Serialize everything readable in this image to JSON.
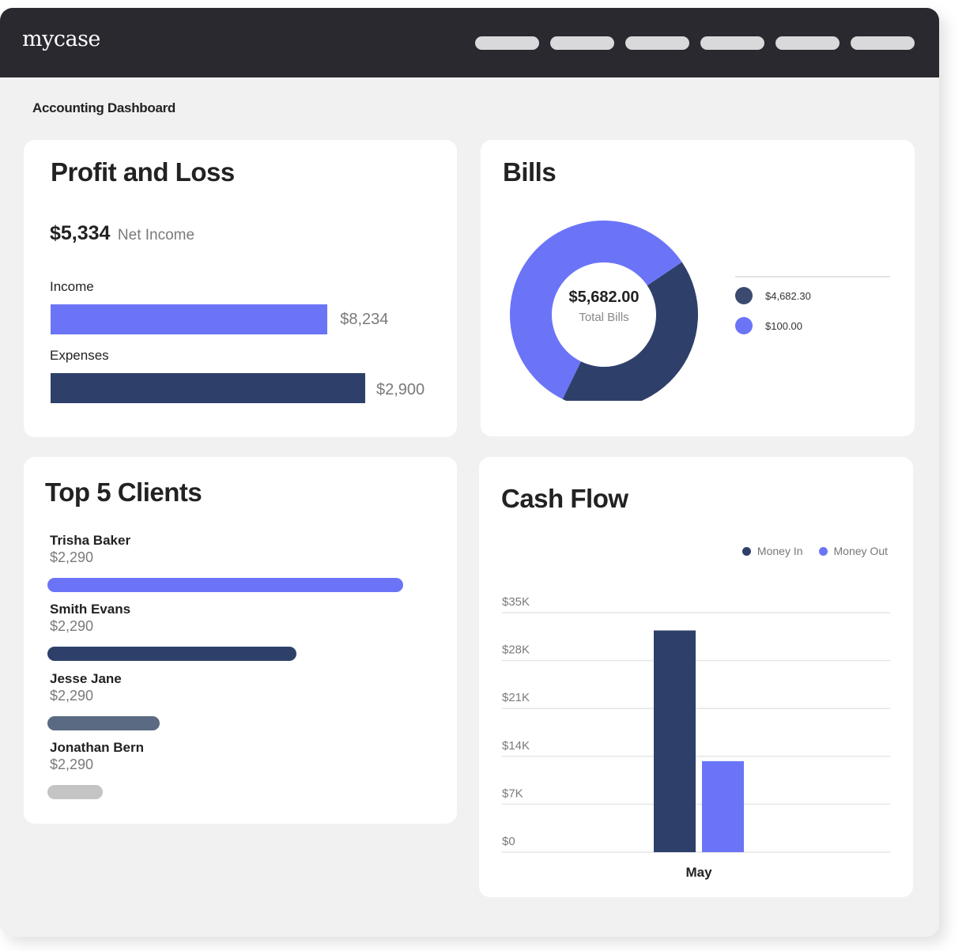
{
  "app": {
    "logo": "mycase",
    "nav_pill_count": 6,
    "page_title": "Accounting Dashboard"
  },
  "colors": {
    "topbar": "#2a292f",
    "accent_light": "#6b74f7",
    "accent_dark": "#2e406a",
    "slate": "#5a6a82",
    "gray_bar": "#c4c4c4"
  },
  "profit_loss": {
    "title": "Profit and Loss",
    "net_value": "$5,334",
    "net_label": "Net Income",
    "income": {
      "label": "Income",
      "value_text": "$8,234",
      "bar_fraction": 0.88
    },
    "expenses": {
      "label": "Expenses",
      "value_text": "$2,900",
      "bar_fraction": 1.0
    }
  },
  "bills": {
    "title": "Bills",
    "total": "$5,682.00",
    "total_label": "Total Bills",
    "legend": [
      {
        "label": "$4,682.30",
        "color": "#3b4a6e"
      },
      {
        "label": "$100.00",
        "color": "#6b74f7"
      }
    ]
  },
  "top_clients": {
    "title": "Top 5 Clients",
    "clients": [
      {
        "name": "Trisha Baker",
        "amount": "$2,290",
        "bar_fraction": 1.0,
        "color": "#6b74f7"
      },
      {
        "name": "Smith Evans",
        "amount": "$2,290",
        "bar_fraction": 0.7,
        "color": "#2e406a"
      },
      {
        "name": "Jesse Jane",
        "amount": "$2,290",
        "bar_fraction": 0.315,
        "color": "#5a6a82"
      },
      {
        "name": "Jonathan Bern",
        "amount": "$2,290",
        "bar_fraction": 0.155,
        "color": "#c4c4c4"
      }
    ]
  },
  "cash_flow": {
    "title": "Cash Flow"
  },
  "chart_data": [
    {
      "type": "pie",
      "title": "Bills",
      "center_text": "$5,682.00",
      "center_subtext": "Total Bills",
      "donut": true,
      "slices": [
        {
          "label": "$4,682.30",
          "fraction": 0.417,
          "color": "#2e406a"
        },
        {
          "label": "$100.00",
          "fraction": 0.583,
          "color": "#6b74f7"
        }
      ],
      "start_angle_deg": 56
    },
    {
      "type": "bar",
      "title": "Cash Flow",
      "categories": [
        "May"
      ],
      "series": [
        {
          "name": "Money In",
          "values": [
            32400
          ],
          "color": "#2e406a"
        },
        {
          "name": "Money Out",
          "values": [
            13300
          ],
          "color": "#6b74f7"
        }
      ],
      "xlabel": "",
      "ylabel": "",
      "ylim": [
        0,
        35000
      ],
      "yticks": [
        0,
        7000,
        14000,
        21000,
        28000,
        35000
      ],
      "ytick_labels": [
        "$0",
        "$7K",
        "$14K",
        "$21K",
        "$28K",
        "$35K"
      ],
      "grid": true,
      "legend": "top-right"
    }
  ]
}
